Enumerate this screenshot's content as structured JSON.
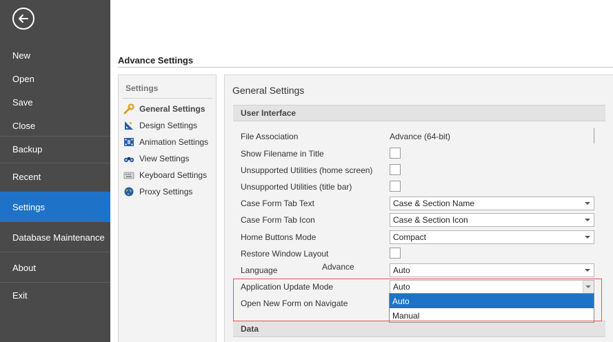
{
  "nav": {
    "items": [
      {
        "label": "New"
      },
      {
        "label": "Open"
      },
      {
        "label": "Save"
      },
      {
        "label": "Close"
      },
      {
        "label": "Backup"
      },
      {
        "label": "Recent"
      },
      {
        "label": "Settings"
      },
      {
        "label": "Database Maintenance"
      },
      {
        "label": "About"
      },
      {
        "label": "Exit"
      }
    ],
    "active": "Settings"
  },
  "page": {
    "title": "Advance Settings"
  },
  "categories": {
    "heading": "Settings",
    "items": [
      {
        "label": "General Settings",
        "icon": "wrench-icon"
      },
      {
        "label": "Design Settings",
        "icon": "ruler-icon"
      },
      {
        "label": "Animation Settings",
        "icon": "film-icon"
      },
      {
        "label": "View Settings",
        "icon": "binoculars-icon"
      },
      {
        "label": "Keyboard Settings",
        "icon": "keyboard-icon"
      },
      {
        "label": "Proxy Settings",
        "icon": "globe-icon"
      }
    ],
    "active": "General Settings"
  },
  "general": {
    "title": "General Settings",
    "user_interface_header": "User Interface",
    "data_header": "Data",
    "rows": {
      "file_association": {
        "label": "File Association",
        "value": "Advance (64-bit)"
      },
      "show_filename": {
        "label": "Show Filename in Title"
      },
      "unsupported_home": {
        "label": "Unsupported Utilities (home screen)"
      },
      "unsupported_title": {
        "label": "Unsupported Utilities (title bar)"
      },
      "case_form_tab_text": {
        "label": "Case Form Tab Text",
        "value": "Case & Section Name"
      },
      "case_form_tab_icon": {
        "label": "Case Form Tab Icon",
        "value": "Case & Section Icon"
      },
      "home_buttons_mode": {
        "label": "Home Buttons Mode",
        "value": "Compact"
      },
      "restore_window_layout": {
        "label": "Restore Window Layout"
      },
      "language": {
        "label": "Language",
        "value": "Auto"
      },
      "app_update_mode": {
        "label": "Application Update Mode",
        "value": "Auto"
      },
      "open_new_form": {
        "label": "Open New Form on Navigate"
      }
    },
    "floating_label": "Advance",
    "update_mode_options": [
      "Auto",
      "Manual"
    ],
    "update_mode_selected": "Auto"
  },
  "colors": {
    "accent": "#1e73c8",
    "nav_bg": "#4a4a4a",
    "highlight": "#e05555"
  }
}
